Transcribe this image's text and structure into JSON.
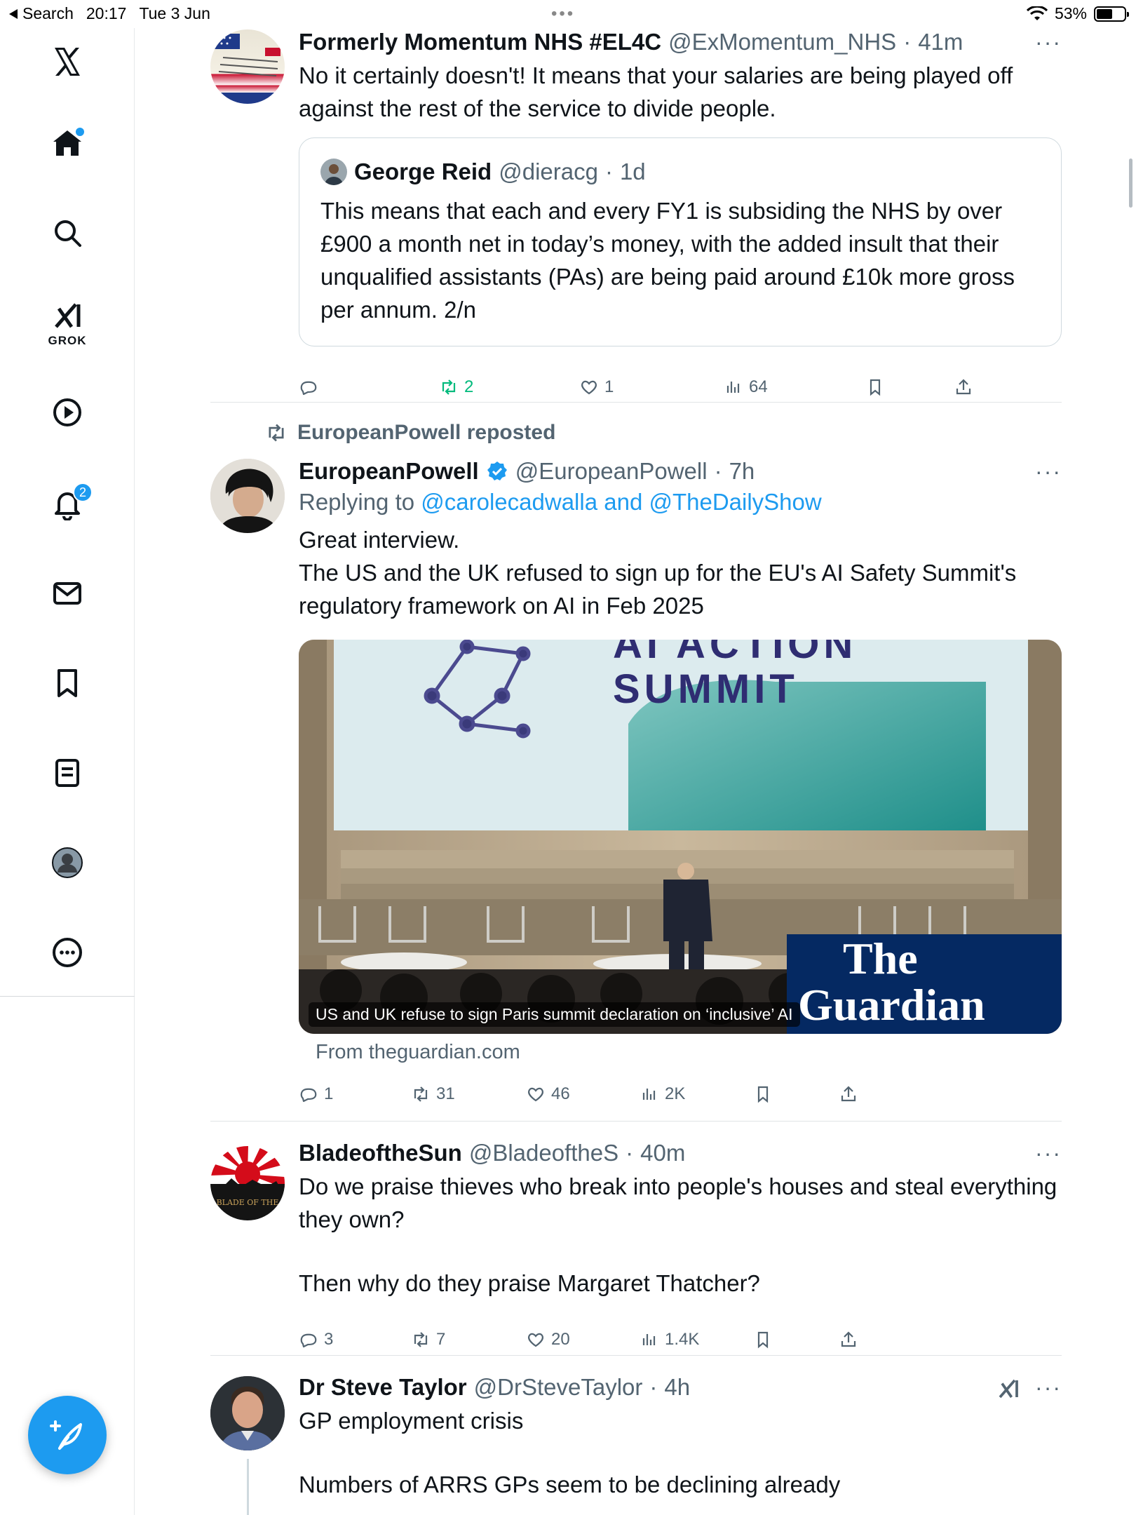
{
  "status_bar": {
    "back_label": "Search",
    "time": "20:17",
    "date": "Tue 3 Jun",
    "battery": "53%",
    "battery_level": 0.53
  },
  "sidebar": {
    "grok_label": "GROK",
    "notifications_badge": "2"
  },
  "tweets": [
    {
      "name": "Formerly Momentum NHS #EL4C",
      "handle": "@ExMomentum_NHS",
      "time": "41m",
      "text": "No it certainly doesn't! It means that your salaries are being played off against the rest of the service to divide people.",
      "quote": {
        "name": "George Reid",
        "handle": "@dieracg",
        "time": "1d",
        "text": "This means that each and every FY1 is subsiding the NHS by over £900 a month net in today’s money, with the added insult that their unqualified assistants (PAs) are being paid around £10k more gross per annum. 2/n"
      },
      "actions": {
        "replies": "",
        "reposts": "2",
        "likes": "1",
        "views": "64"
      }
    },
    {
      "repost_label": "EuropeanPowell reposted",
      "name": "EuropeanPowell",
      "handle": "@EuropeanPowell",
      "time": "7h",
      "replying_prefix": "Replying to",
      "replying_handles": "@carolecadwalla and @TheDailyShow",
      "text_lines": [
        "Great interview.",
        "The US and the UK refused to sign up for the EU's AI Safety Summit's regulatory framework on AI in Feb 2025"
      ],
      "media": {
        "banner_line1": "AI ACTION",
        "banner_line2": "SUMMIT",
        "brand_line1": "The",
        "brand_line2": "Guardian",
        "caption": "US and UK refuse to sign Paris summit declaration on ‘inclusive’ AI",
        "source": "From theguardian.com"
      },
      "actions": {
        "replies": "1",
        "reposts": "31",
        "likes": "46",
        "views": "2K"
      }
    },
    {
      "name": "BladeoftheSun",
      "handle": "@BladeoftheS",
      "time": "40m",
      "avatar_text": "BLADE OF THE",
      "text_lines": [
        "Do we praise thieves who break into people's houses and steal everything they own?",
        "",
        "Then why do they praise Margaret Thatcher?"
      ],
      "actions": {
        "replies": "3",
        "reposts": "7",
        "likes": "20",
        "views": "1.4K"
      }
    },
    {
      "name": "Dr Steve Taylor",
      "handle": "@DrSteveTaylor",
      "time": "4h",
      "text_lines": [
        "GP employment crisis",
        "",
        "Numbers of ARRS GPs seem to be declining already"
      ]
    }
  ],
  "colors": {
    "accent": "#1d9bf0",
    "repost_green": "#00ba7c",
    "secondary_text": "#536471",
    "guardian_blue": "#052962"
  }
}
